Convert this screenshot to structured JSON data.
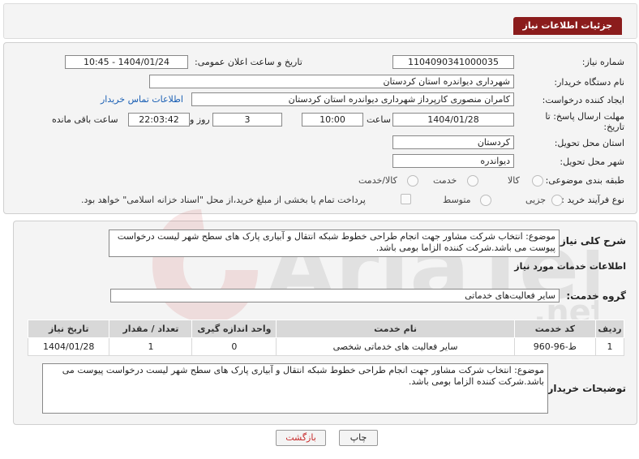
{
  "header": {
    "title": "جزئیات اطلاعات نیاز"
  },
  "fields": {
    "need_number_label": "شماره نیاز:",
    "need_number": "1104090341000035",
    "announce_label": "تاریخ و ساعت اعلان عمومی:",
    "announce_value": "1404/01/24 - 10:45",
    "buyer_org_label": "نام دستگاه خریدار:",
    "buyer_org": "شهرداری دیواندره استان کردستان",
    "requester_label": "ایجاد کننده درخواست:",
    "requester": "کامران منصوری کارپرداز شهرداری دیواندره استان کردستان",
    "contact_link": "اطلاعات تماس خریدار",
    "deadline_label_1": "مهلت ارسال پاسخ: تا",
    "deadline_label_2": "تاریخ:",
    "deadline_date": "1404/01/28",
    "time_label": "ساعت",
    "deadline_time": "10:00",
    "days_value": "3",
    "days_label": "روز و",
    "remaining_time": "22:03:42",
    "remaining_label": "ساعت باقی مانده",
    "province_label": "استان محل تحویل:",
    "province": "کردستان",
    "city_label": "شهر محل تحویل:",
    "city": "دیواندره",
    "category_label": "طبقه بندی موضوعی:",
    "category_options": [
      "کالا",
      "خدمت",
      "کالا/خدمت"
    ],
    "process_label": "نوع فرآیند خرید :",
    "process_options": [
      "جزیی",
      "متوسط"
    ],
    "payment_note": "پرداخت تمام یا بخشی از مبلغ خرید،از محل \"اسناد خزانه اسلامی\" خواهد بود."
  },
  "summary": {
    "label": "شرح کلی نیاز:",
    "text": "موضوع: انتخاب شرکت مشاور جهت انجام طراحی خطوط شبکه انتقال و آبیاری پارک های سطح شهر لیست درخواست پیوست می باشد.شرکت کننده الزاما بومی باشد."
  },
  "services": {
    "section_title": "اطلاعات خدمات مورد نیاز",
    "group_label": "گروه خدمت:",
    "group_value": "سایر فعالیت‌های خدماتی",
    "columns": [
      "ردیف",
      "کد خدمت",
      "نام خدمت",
      "واحد اندازه گیری",
      "تعداد / مقدار",
      "تاریخ نیاز"
    ],
    "rows": [
      [
        "1",
        "ط-96-960",
        "سایر فعالیت های خدماتی شخصی",
        "0",
        "1",
        "1404/01/28"
      ]
    ]
  },
  "buyer_notes": {
    "label": "توضیحات خریدار:",
    "text": "موضوع: انتخاب شرکت مشاور جهت انجام طراحی خطوط شبکه انتقال و آبیاری پارک های سطح شهر لیست درخواست پیوست می باشد.شرکت کننده الزاما بومی باشد."
  },
  "buttons": {
    "print": "چاپ",
    "back": "بازگشت"
  },
  "colors": {
    "header_bg": "#8b1c1c",
    "link": "#1a5fb4",
    "back_button_text": "#c62828"
  }
}
